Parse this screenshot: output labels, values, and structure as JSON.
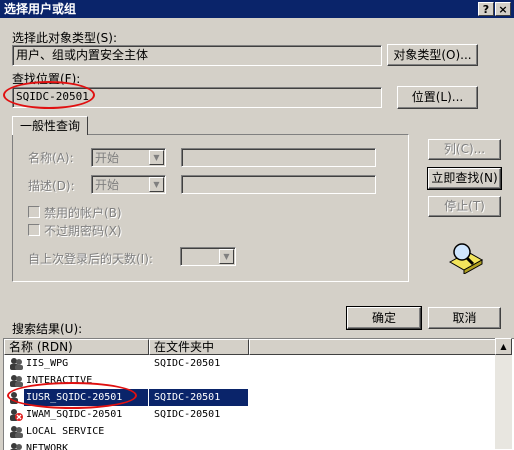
{
  "window": {
    "title": "选择用户或组",
    "help_label": "?",
    "close_label": "×"
  },
  "object_type": {
    "label": "选择此对象类型(S):",
    "value": "用户、组或内置安全主体",
    "button_label": "对象类型(O)..."
  },
  "location": {
    "label": "查找位置(F):",
    "value": "SQIDC-20501",
    "button_label": "位置(L)..."
  },
  "query": {
    "tab_label": "一般性查询",
    "name_label": "名称(A):",
    "name_mode": "开始",
    "desc_label": "描述(D):",
    "desc_mode": "开始",
    "disabled_accounts_label": "禁用的帐户(B)",
    "non_expiring_label": "不过期密码(X)",
    "days_label": "自上次登录后的天数(I):"
  },
  "side_buttons": {
    "columns_label": "列(C)...",
    "find_now_label": "立即查找(N)",
    "stop_label": "停止(T)"
  },
  "footer_buttons": {
    "ok_label": "确定",
    "cancel_label": "取消"
  },
  "results": {
    "label": "搜索结果(U):",
    "columns": [
      "名称 (RDN)",
      "在文件夹中"
    ],
    "rows": [
      {
        "name": "IIS_WPG",
        "folder": "SQIDC-20501",
        "icon": "group-icon",
        "selected": false
      },
      {
        "name": "INTERACTIVE",
        "folder": "",
        "icon": "group-icon",
        "selected": false
      },
      {
        "name": "IUSR_SQIDC-20501",
        "folder": "SQIDC-20501",
        "icon": "user-icon",
        "selected": true
      },
      {
        "name": "IWAM_SQIDC-20501",
        "folder": "SQIDC-20501",
        "icon": "disabled-user-icon",
        "selected": false
      },
      {
        "name": "LOCAL SERVICE",
        "folder": "",
        "icon": "group-icon",
        "selected": false
      },
      {
        "name": "NETWORK",
        "folder": "",
        "icon": "group-icon",
        "selected": false
      }
    ]
  },
  "colors": {
    "titlebar": "#0a246a",
    "dialog_bg": "#d4d0c8",
    "selection": "#0a246a",
    "annotation": "#e01010"
  }
}
